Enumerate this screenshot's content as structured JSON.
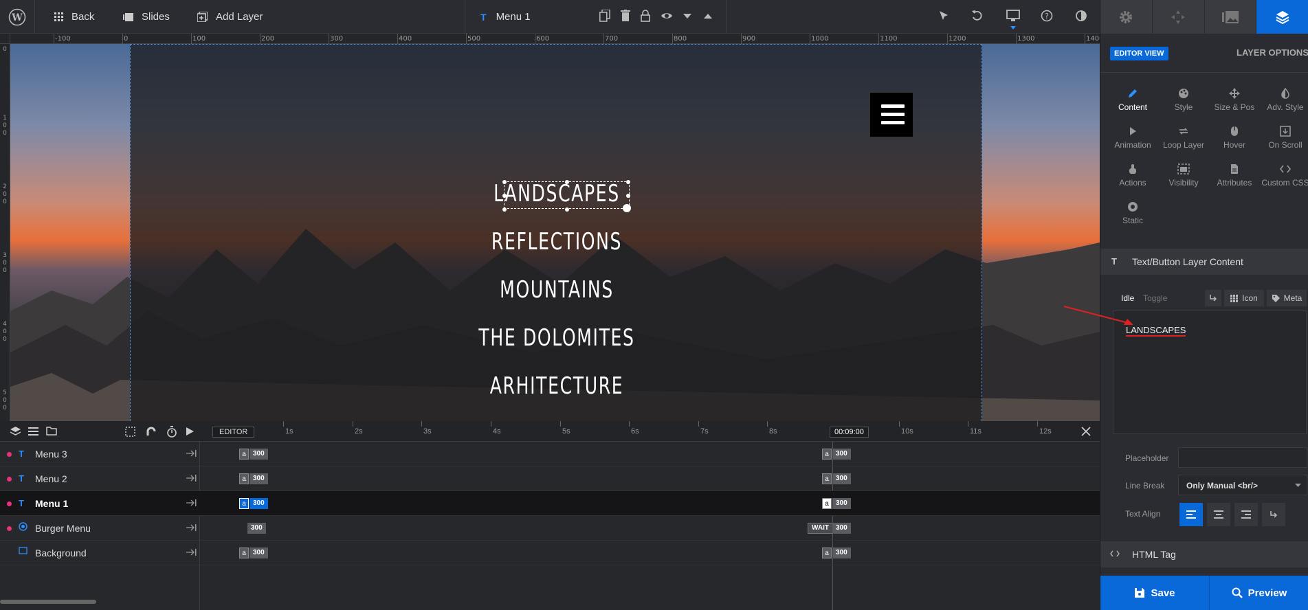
{
  "topbar": {
    "back": "Back",
    "slides": "Slides",
    "add_layer": "Add Layer",
    "layer_name": "Menu 1"
  },
  "ruler": {
    "labels": [
      "-100",
      "0",
      "100",
      "200",
      "300",
      "400",
      "500",
      "600",
      "700",
      "800",
      "900",
      "1000",
      "1100",
      "1200",
      "1300",
      "1400"
    ]
  },
  "vruler": {
    "labels": [
      "0",
      "1 0 0",
      "2 0 0",
      "3 0 0",
      "4 0 0",
      "5 0 0"
    ]
  },
  "canvas": {
    "menu_items": [
      "LANDSCAPES",
      "REFLECTIONS",
      "MOUNTAINS",
      "THE DOLOMITES",
      "ARHITECTURE"
    ]
  },
  "timeline": {
    "editor_label": "EDITOR",
    "ticks": [
      "1s",
      "2s",
      "3s",
      "4s",
      "5s",
      "6s",
      "7s",
      "8s",
      "10s",
      "11s",
      "12s"
    ],
    "current_time": "00:09:00",
    "rows": [
      {
        "name": "Menu 3",
        "type": "text",
        "start_a": "a",
        "start": "300",
        "end_a": "a",
        "end": "300"
      },
      {
        "name": "Menu 2",
        "type": "text",
        "start_a": "a",
        "start": "300",
        "end_a": "a",
        "end": "300"
      },
      {
        "name": "Menu 1",
        "type": "text",
        "start_a": "a",
        "start": "300",
        "end_a": "a",
        "end": "300"
      },
      {
        "name": "Burger Menu",
        "type": "module",
        "start": "300",
        "end_wait": "WAIT",
        "end": "300"
      },
      {
        "name": "Background",
        "type": "shape",
        "start_a": "a",
        "start": "300",
        "end_a": "a",
        "end": "300"
      }
    ]
  },
  "rpanel": {
    "editor_view": "EDITOR VIEW",
    "layer_options": "LAYER OPTIONS",
    "options": [
      "Content",
      "Style",
      "Size & Pos",
      "Adv. Style",
      "Animation",
      "Loop Layer",
      "Hover",
      "On Scroll",
      "Actions",
      "Visibility",
      "Attributes",
      "Custom CSS",
      "Static"
    ],
    "section_content": "Text/Button Layer Content",
    "idle": "Idle",
    "toggle": "Toggle",
    "icon": "Icon",
    "meta": "Meta",
    "content_text": "LANDSCAPES",
    "placeholder_label": "Placeholder",
    "linebreak_label": "Line Break",
    "linebreak_value": "Only Manual <br/>",
    "textalign_label": "Text Align",
    "section_html": "HTML Tag",
    "save": "Save",
    "preview": "Preview"
  },
  "colors": {
    "accent": "#0969d8",
    "pink": "#e8327c"
  }
}
